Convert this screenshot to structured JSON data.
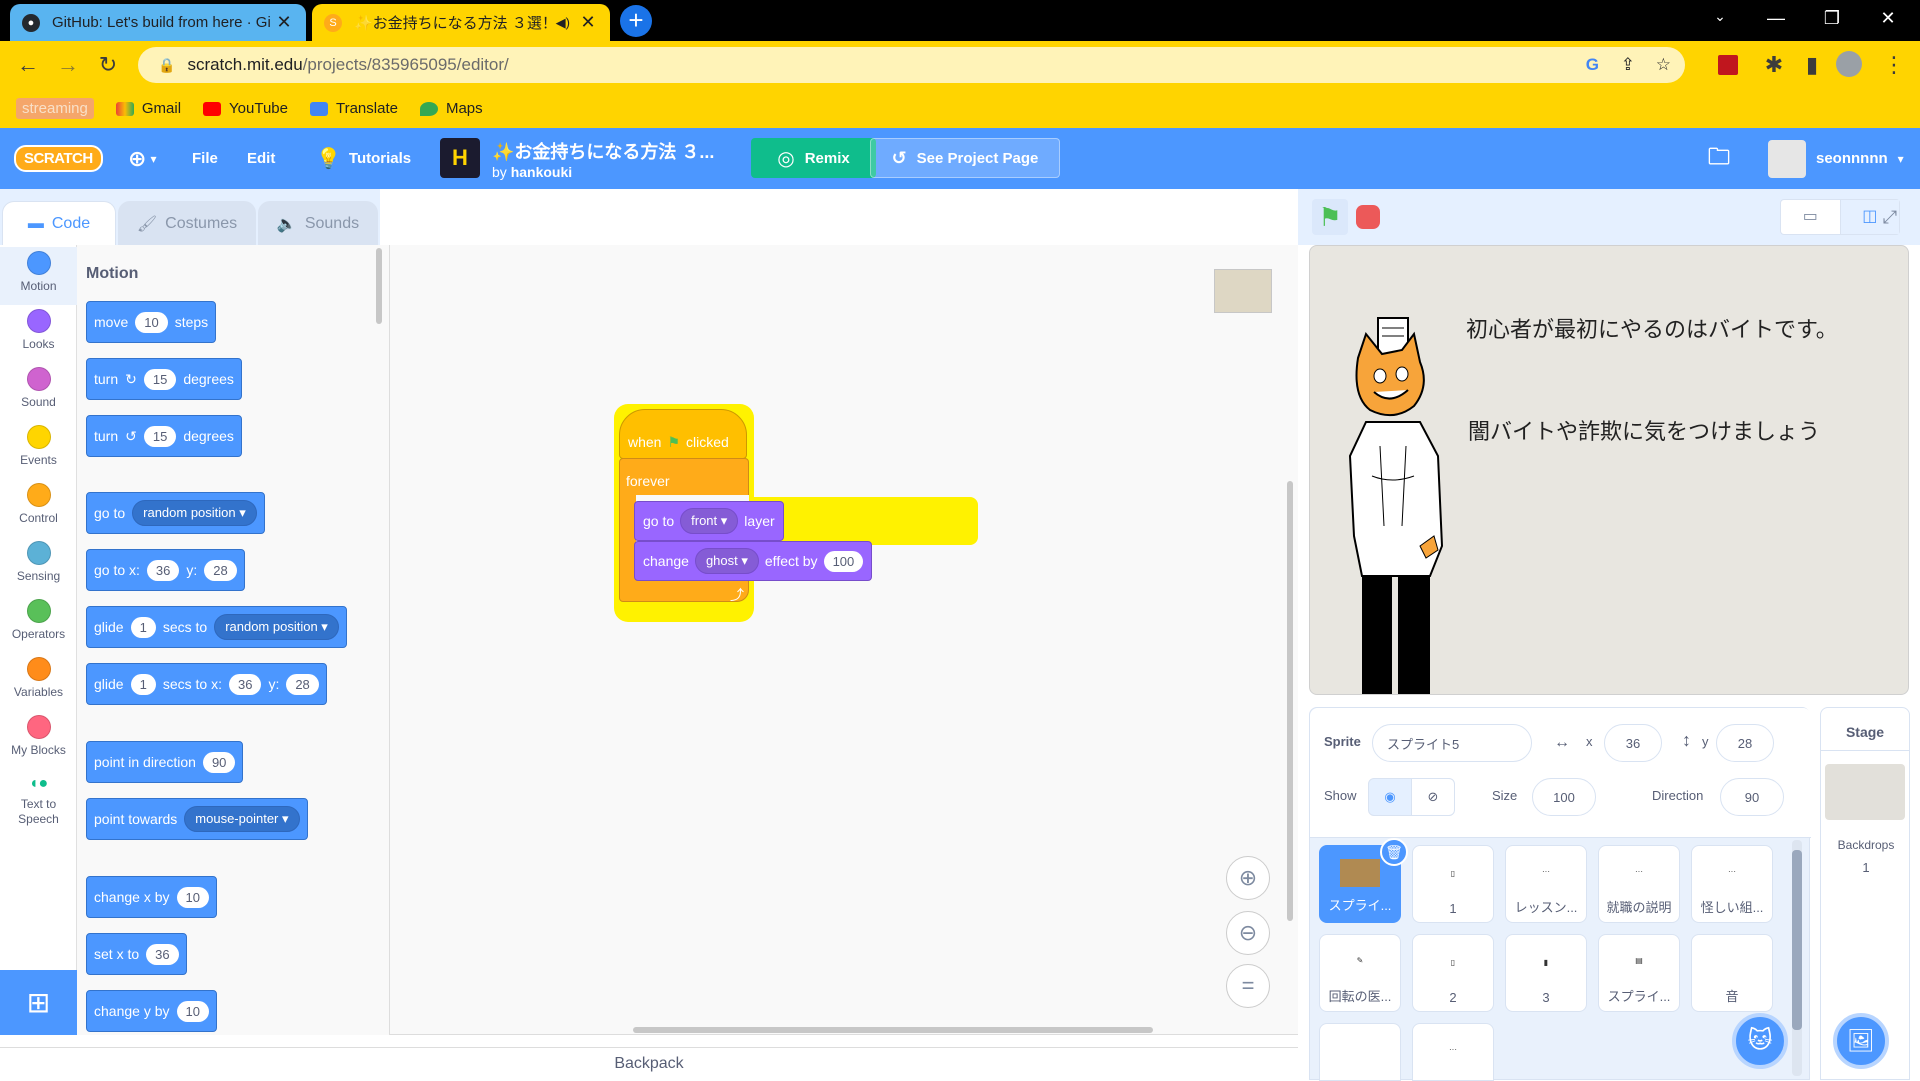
{
  "browser": {
    "tabs": [
      {
        "title": "GitHub: Let's build from here · Gi",
        "active": false
      },
      {
        "title": "✨お金持ちになる方法 ３選！",
        "active": true
      }
    ],
    "url_host": "scratch.mit.edu",
    "url_path": "/projects/835965095/editor/",
    "bookmarks": [
      "streaming",
      "Gmail",
      "YouTube",
      "Translate",
      "Maps"
    ]
  },
  "menubar": {
    "logo": "SCRATCH",
    "file": "File",
    "edit": "Edit",
    "tutorials": "Tutorials",
    "project_title": "✨お金持ちになる方法 ３...",
    "by": "by",
    "author": "hankouki",
    "remix": "Remix",
    "see_project": "See Project Page",
    "username": "seonnnnn"
  },
  "editor_tabs": [
    "Code",
    "Costumes",
    "Sounds"
  ],
  "categories": [
    {
      "label": "Motion",
      "color": "#4c97ff"
    },
    {
      "label": "Looks",
      "color": "#9966ff"
    },
    {
      "label": "Sound",
      "color": "#cf63cf"
    },
    {
      "label": "Events",
      "color": "#ffd500"
    },
    {
      "label": "Control",
      "color": "#ffab19"
    },
    {
      "label": "Sensing",
      "color": "#5cb1d6"
    },
    {
      "label": "Operators",
      "color": "#59c059"
    },
    {
      "label": "Variables",
      "color": "#ff8c1a"
    },
    {
      "label": "My Blocks",
      "color": "#ff6680"
    },
    {
      "label": "Text to Speech",
      "color": "#0fbd8c"
    }
  ],
  "palette": {
    "heading": "Motion",
    "move": {
      "a": "move",
      "n": "10",
      "b": "steps"
    },
    "turn_right": {
      "a": "turn",
      "n": "15",
      "b": "degrees"
    },
    "turn_left": {
      "a": "turn",
      "n": "15",
      "b": "degrees"
    },
    "goto": {
      "a": "go to",
      "dd": "random position"
    },
    "gotoxy": {
      "a": "go to x:",
      "x": "36",
      "b": "y:",
      "y": "28"
    },
    "glide_to": {
      "a": "glide",
      "n": "1",
      "b": "secs to",
      "dd": "random position"
    },
    "glide_xy": {
      "a": "glide",
      "n": "1",
      "b": "secs to x:",
      "x": "36",
      "c": "y:",
      "y": "28"
    },
    "point_dir": {
      "a": "point in direction",
      "n": "90"
    },
    "point_towards": {
      "a": "point towards",
      "dd": "mouse-pointer"
    },
    "change_x": {
      "a": "change x by",
      "n": "10"
    },
    "set_x": {
      "a": "set x to",
      "n": "36"
    },
    "change_y": {
      "a": "change y by",
      "n": "10"
    }
  },
  "script": {
    "hat": {
      "a": "when",
      "b": "clicked"
    },
    "forever": "forever",
    "goto_layer": {
      "a": "go to",
      "dd": "front",
      "b": "layer"
    },
    "change_effect": {
      "a": "change",
      "dd": "ghost",
      "b": "effect by",
      "n": "100"
    }
  },
  "backpack": "Backpack",
  "stage": {
    "line1": "初心者が最初にやるのはバイトです。",
    "line2": "闇バイトや詐欺に気をつけましょう"
  },
  "sprite_info": {
    "sprite_label": "Sprite",
    "sprite_name": "スプライト5",
    "x_label": "x",
    "x": "36",
    "y_label": "y",
    "y": "28",
    "show_label": "Show",
    "size_label": "Size",
    "size": "100",
    "direction_label": "Direction",
    "direction": "90"
  },
  "sprites": [
    {
      "name": "スプライ...",
      "selected": true
    },
    {
      "name": "1"
    },
    {
      "name": "レッスン..."
    },
    {
      "name": "就職の説明"
    },
    {
      "name": "怪しい組..."
    },
    {
      "name": "回転の医..."
    },
    {
      "name": "2"
    },
    {
      "name": "3"
    },
    {
      "name": "スプライ..."
    },
    {
      "name": "音"
    },
    {
      "name": ""
    },
    {
      "name": ""
    }
  ],
  "stage_panel": {
    "title": "Stage",
    "backdrops_label": "Backdrops",
    "backdrops_count": "1"
  }
}
